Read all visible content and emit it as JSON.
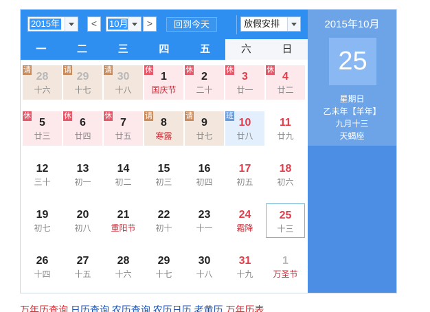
{
  "toolbar": {
    "year": "2015年",
    "month": "10月",
    "prev": "<",
    "next": ">",
    "today_button": "回到今天",
    "holiday_select": "放假安排"
  },
  "weekdays": [
    "一",
    "二",
    "三",
    "四",
    "五",
    "六",
    "日"
  ],
  "side": {
    "title": "2015年10月",
    "day": "25",
    "weekday": "星期日",
    "ganzhi": "乙未年【羊年】",
    "lunar": "九月十三",
    "zodiac": "天蝎座"
  },
  "days": [
    {
      "d": "28",
      "l": "十六",
      "tag": "请",
      "kind": "leave",
      "color": "grey"
    },
    {
      "d": "29",
      "l": "十七",
      "tag": "请",
      "kind": "leave",
      "color": "grey"
    },
    {
      "d": "30",
      "l": "十八",
      "tag": "请",
      "kind": "leave",
      "color": "grey"
    },
    {
      "d": "1",
      "l": "国庆节",
      "tag": "休",
      "kind": "rest",
      "color": "",
      "fest": true
    },
    {
      "d": "2",
      "l": "二十",
      "tag": "休",
      "kind": "rest",
      "color": ""
    },
    {
      "d": "3",
      "l": "廿一",
      "tag": "休",
      "kind": "rest",
      "color": "red"
    },
    {
      "d": "4",
      "l": "廿二",
      "tag": "休",
      "kind": "rest",
      "color": "red"
    },
    {
      "d": "5",
      "l": "廿三",
      "tag": "休",
      "kind": "rest",
      "color": ""
    },
    {
      "d": "6",
      "l": "廿四",
      "tag": "休",
      "kind": "rest",
      "color": ""
    },
    {
      "d": "7",
      "l": "廿五",
      "tag": "休",
      "kind": "rest",
      "color": ""
    },
    {
      "d": "8",
      "l": "寒露",
      "tag": "请",
      "kind": "leave",
      "color": "",
      "fest": true
    },
    {
      "d": "9",
      "l": "廿七",
      "tag": "请",
      "kind": "leave",
      "color": ""
    },
    {
      "d": "10",
      "l": "廿八",
      "tag": "班",
      "kind": "work",
      "color": "red"
    },
    {
      "d": "11",
      "l": "廿九",
      "tag": "",
      "kind": "",
      "color": "red"
    },
    {
      "d": "12",
      "l": "三十",
      "tag": "",
      "kind": "",
      "color": ""
    },
    {
      "d": "13",
      "l": "初一",
      "tag": "",
      "kind": "",
      "color": ""
    },
    {
      "d": "14",
      "l": "初二",
      "tag": "",
      "kind": "",
      "color": ""
    },
    {
      "d": "15",
      "l": "初三",
      "tag": "",
      "kind": "",
      "color": ""
    },
    {
      "d": "16",
      "l": "初四",
      "tag": "",
      "kind": "",
      "color": ""
    },
    {
      "d": "17",
      "l": "初五",
      "tag": "",
      "kind": "",
      "color": "red"
    },
    {
      "d": "18",
      "l": "初六",
      "tag": "",
      "kind": "",
      "color": "red"
    },
    {
      "d": "19",
      "l": "初七",
      "tag": "",
      "kind": "",
      "color": ""
    },
    {
      "d": "20",
      "l": "初八",
      "tag": "",
      "kind": "",
      "color": ""
    },
    {
      "d": "21",
      "l": "重阳节",
      "tag": "",
      "kind": "",
      "color": "",
      "fest": true
    },
    {
      "d": "22",
      "l": "初十",
      "tag": "",
      "kind": "",
      "color": ""
    },
    {
      "d": "23",
      "l": "十一",
      "tag": "",
      "kind": "",
      "color": ""
    },
    {
      "d": "24",
      "l": "霜降",
      "tag": "",
      "kind": "",
      "color": "red",
      "fest": true
    },
    {
      "d": "25",
      "l": "十三",
      "tag": "",
      "kind": "",
      "color": "red",
      "today": true
    },
    {
      "d": "26",
      "l": "十四",
      "tag": "",
      "kind": "",
      "color": ""
    },
    {
      "d": "27",
      "l": "十五",
      "tag": "",
      "kind": "",
      "color": ""
    },
    {
      "d": "28",
      "l": "十六",
      "tag": "",
      "kind": "",
      "color": ""
    },
    {
      "d": "29",
      "l": "十七",
      "tag": "",
      "kind": "",
      "color": ""
    },
    {
      "d": "30",
      "l": "十八",
      "tag": "",
      "kind": "",
      "color": ""
    },
    {
      "d": "31",
      "l": "十九",
      "tag": "",
      "kind": "",
      "color": "red"
    },
    {
      "d": "1",
      "l": "万圣节",
      "tag": "",
      "kind": "",
      "color": "grey",
      "fest": true
    }
  ],
  "links": [
    {
      "text": "万年历查询",
      "color": "red"
    },
    {
      "text": "日历查询",
      "color": "blue"
    },
    {
      "text": "农历查询",
      "color": "blue"
    },
    {
      "text": "农历日历",
      "color": "blue"
    },
    {
      "text": "老黄历",
      "color": "blue"
    },
    {
      "text": "万年历表",
      "color": "red"
    }
  ]
}
